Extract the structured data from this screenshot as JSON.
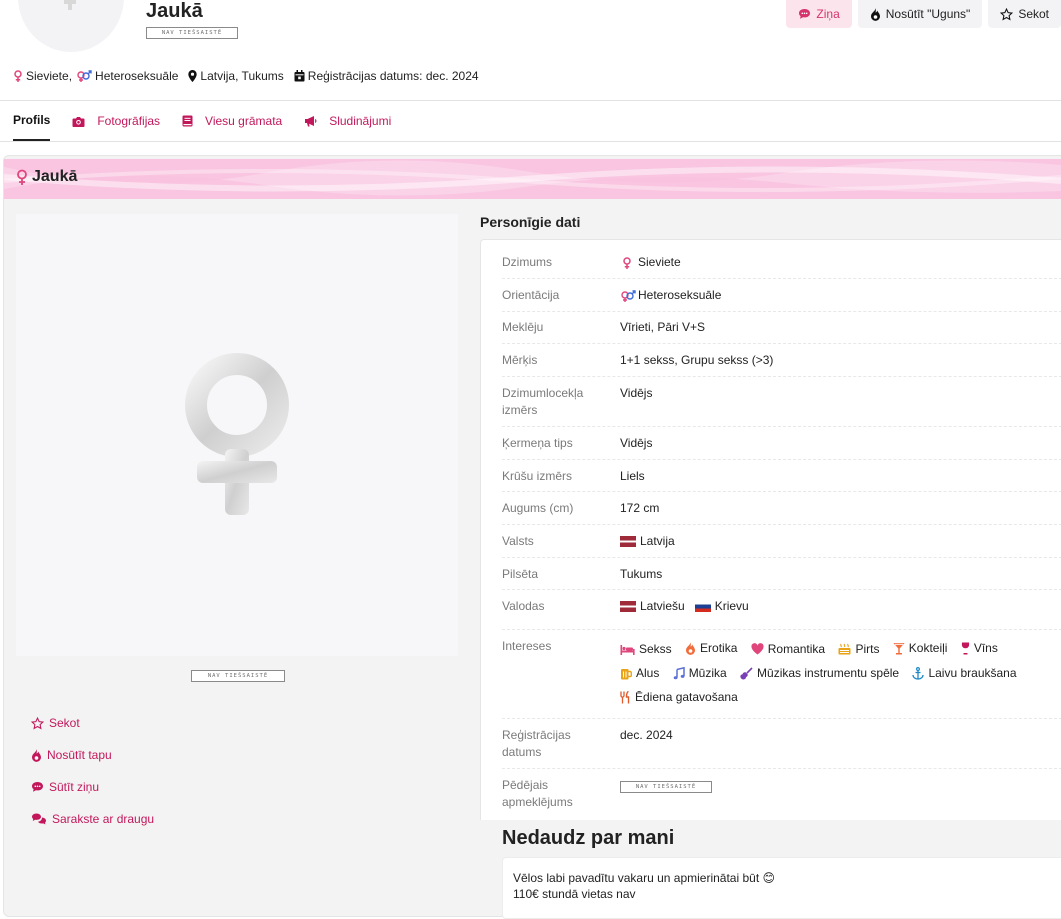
{
  "header": {
    "username": "Jaukā",
    "status_badge": "NAV TIEŠSAISTĒ",
    "actions": [
      {
        "label": "Ziņa",
        "icon": "chat-bubble-icon"
      },
      {
        "label": "Nosūtīt \"Uguns\"",
        "icon": "fire-icon"
      },
      {
        "label": "Sekot",
        "icon": "star-icon"
      }
    ],
    "meta": {
      "gender": "Sieviete,",
      "orientation": "Heteroseksuāle",
      "location": "Latvija, Tukums",
      "registration": "Reģistrācijas datums: dec. 2024"
    }
  },
  "tabs": [
    {
      "label": "Profils",
      "active": true
    },
    {
      "label": "Fotogrāfijas",
      "icon": "camera-icon"
    },
    {
      "label": "Viesu grāmata",
      "icon": "book-icon"
    },
    {
      "label": "Sludinājumi",
      "icon": "megaphone-icon"
    }
  ],
  "card": {
    "title": "Jaukā",
    "photo_badge": "NAV TIEŠSAISTĒ",
    "actions": [
      {
        "label": "Sekot",
        "icon": "star-icon"
      },
      {
        "label": "Nosūtīt tapu",
        "icon": "fire-icon"
      },
      {
        "label": "Sūtīt ziņu",
        "icon": "chat-bubble-icon"
      },
      {
        "label": "Sarakste ar draugu",
        "icon": "chats-icon"
      }
    ]
  },
  "personal": {
    "title": "Personīgie dati",
    "rows": [
      {
        "label": "Dzimums",
        "value": "Sieviete"
      },
      {
        "label": "Orientācija",
        "value": "Heteroseksuāle"
      },
      {
        "label": "Meklēju",
        "value": "Vīrieti, Pāri V+S"
      },
      {
        "label": "Mērķis",
        "value": "1+1 sekss, Grupu sekss (>3)"
      },
      {
        "label": "Dzimumlocekļa izmērs",
        "value": "Vidējs"
      },
      {
        "label": "Ķermeņa tips",
        "value": "Vidējs"
      },
      {
        "label": "Krūšu izmērs",
        "value": "Liels"
      },
      {
        "label": "Augums (cm)",
        "value": "172 cm"
      },
      {
        "label": "Valsts",
        "value": "Latvija"
      },
      {
        "label": "Pilsēta",
        "value": "Tukums"
      },
      {
        "label": "Valodas",
        "value_1": "Latviešu",
        "value_2": "Krievu"
      },
      {
        "label": "Intereses"
      },
      {
        "label": "Reģistrācijas datums",
        "value": "dec. 2024"
      },
      {
        "label": "Pēdējais apmeklējums",
        "value": "NAV TIEŠSAISTĒ"
      }
    ],
    "interests": [
      {
        "label": "Sekss",
        "icon": "bed-icon"
      },
      {
        "label": "Erotika",
        "icon": "fire-icon"
      },
      {
        "label": "Romantika",
        "icon": "heart-icon"
      },
      {
        "label": "Pirts",
        "icon": "sauna-icon"
      },
      {
        "label": "Kokteiļi",
        "icon": "cocktail-icon"
      },
      {
        "label": "Vīns",
        "icon": "wine-icon"
      },
      {
        "label": "Alus",
        "icon": "beer-icon"
      },
      {
        "label": "Mūzika",
        "icon": "music-icon"
      },
      {
        "label": "Mūzikas instrumentu spēle",
        "icon": "guitar-icon"
      },
      {
        "label": "Laivu braukšana",
        "icon": "anchor-icon"
      },
      {
        "label": "Ēdiena gatavošana",
        "icon": "utensils-icon"
      }
    ]
  },
  "about": {
    "title": "Nedaudz par mani",
    "text": "Vēlos labi pavadītu vakaru un apmierinātai būt 😊\n110€ stundā vietas nav"
  },
  "colors": {
    "accent": "#c2185b",
    "banner": "#fbd3e9",
    "female": "#e0457b",
    "male": "#3f6ad8"
  }
}
